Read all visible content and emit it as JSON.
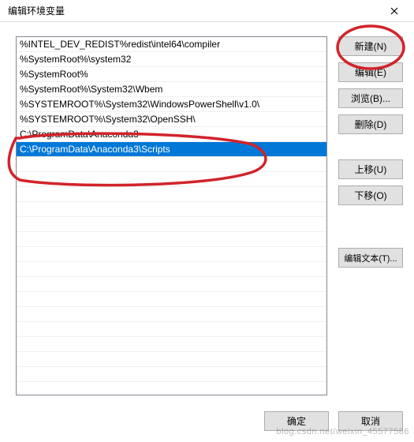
{
  "window": {
    "title": "编辑环境变量"
  },
  "list": {
    "items": [
      "%INTEL_DEV_REDIST%redist\\intel64\\compiler",
      "%SystemRoot%\\system32",
      "%SystemRoot%",
      "%SystemRoot%\\System32\\Wbem",
      "%SYSTEMROOT%\\System32\\WindowsPowerShell\\v1.0\\",
      "%SYSTEMROOT%\\System32\\OpenSSH\\",
      "C:\\ProgramData\\Anaconda3",
      "C:\\ProgramData\\Anaconda3\\Scripts"
    ],
    "selectedIndex": 7
  },
  "buttons": {
    "new": "新建(N)",
    "edit": "编辑(E)",
    "browse": "浏览(B)...",
    "delete": "删除(D)",
    "moveUp": "上移(U)",
    "moveDown": "下移(O)",
    "editText": "编辑文本(T)...",
    "ok": "确定",
    "cancel": "取消"
  },
  "watermark": "blog.csdn.net/weixin_45577586"
}
